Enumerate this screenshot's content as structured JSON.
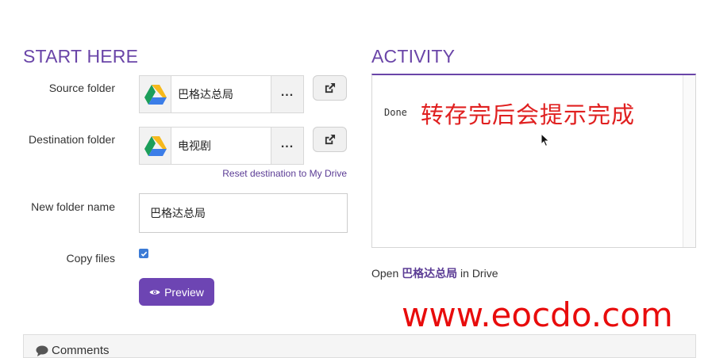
{
  "start": {
    "title": "START HERE",
    "source_label": "Source folder",
    "source_value": "巴格达总局",
    "destination_label": "Destination folder",
    "destination_value": "电视剧",
    "reset_link": "Reset destination to My Drive",
    "new_name_label": "New folder name",
    "new_name_value": "巴格达总局",
    "copy_files_label": "Copy files",
    "copy_files_checked": true,
    "browse_label": "...",
    "preview_label": "Preview"
  },
  "activity": {
    "title": "ACTIVITY",
    "log_text": "Done",
    "annotation": "转存完后会提示完成",
    "open_prefix": "Open",
    "open_folder": "巴格达总局",
    "open_suffix": "in Drive"
  },
  "comments": {
    "label": "Comments"
  },
  "watermark": "www.eocdo.com",
  "colors": {
    "accent": "#6a45a8",
    "button": "#6d45b3",
    "checkbox": "#3b7bd6",
    "annotation": "#e02020"
  },
  "icons": [
    "google-drive-icon",
    "external-link-icon",
    "eye-icon",
    "comment-icon",
    "mouse-cursor-icon"
  ]
}
